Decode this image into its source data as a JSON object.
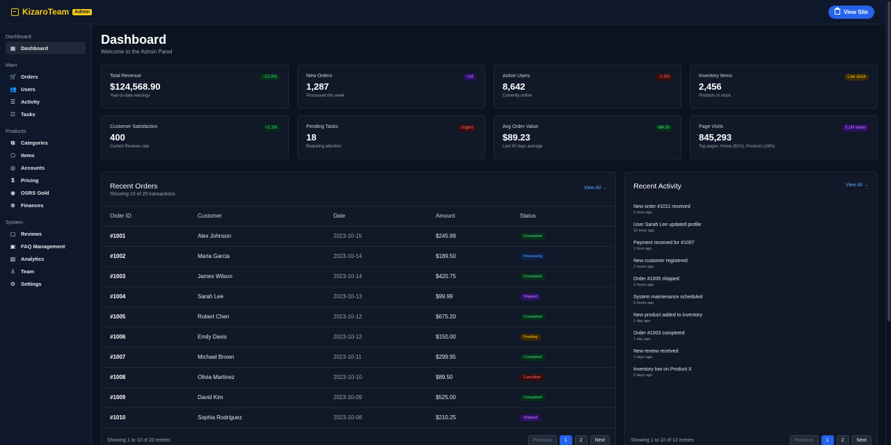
{
  "brand": {
    "name": "KizaroTeam",
    "badge": "Admin"
  },
  "header": {
    "view_site": "View Site"
  },
  "sidebar": {
    "sections": [
      {
        "title": "Dashboard",
        "items": [
          {
            "label": "Dashboard",
            "icon": "grid-icon",
            "active": true
          }
        ]
      },
      {
        "title": "Main",
        "items": [
          {
            "label": "Orders",
            "icon": "cart-icon"
          },
          {
            "label": "Users",
            "icon": "users-icon"
          },
          {
            "label": "Activity",
            "icon": "activity-icon"
          },
          {
            "label": "Tasks",
            "icon": "tasks-icon"
          }
        ]
      },
      {
        "title": "Products",
        "items": [
          {
            "label": "Categories",
            "icon": "categories-icon"
          },
          {
            "label": "Items",
            "icon": "box-icon"
          },
          {
            "label": "Accounts",
            "icon": "account-icon"
          },
          {
            "label": "Pricing",
            "icon": "dollar-icon"
          },
          {
            "label": "OSRS Gold",
            "icon": "coins-icon"
          },
          {
            "label": "Finances",
            "icon": "finance-icon"
          }
        ]
      },
      {
        "title": "System",
        "items": [
          {
            "label": "Reviews",
            "icon": "chat-icon"
          },
          {
            "label": "FAQ Management",
            "icon": "faq-icon"
          },
          {
            "label": "Analytics",
            "icon": "chart-icon"
          },
          {
            "label": "Team",
            "icon": "user-icon"
          },
          {
            "label": "Settings",
            "icon": "gear-icon"
          }
        ]
      }
    ]
  },
  "page": {
    "title": "Dashboard",
    "subtitle": "Welcome to the Admin Panel"
  },
  "stats": [
    {
      "label": "Total Revenue",
      "value": "$124,568.90",
      "sub": "Year-to-date earnings",
      "pill": "+12.5%",
      "pill_color": "green"
    },
    {
      "label": "New Orders",
      "value": "1,287",
      "sub": "Processed this week",
      "pill": "+34",
      "pill_color": "purple"
    },
    {
      "label": "Active Users",
      "value": "8,642",
      "sub": "Currently online",
      "pill": "-2.3%",
      "pill_color": "red"
    },
    {
      "label": "Inventory Items",
      "value": "2,456",
      "sub": "Products in stock",
      "pill": "Low stock",
      "pill_color": "yellow"
    },
    {
      "label": "Customer Satisfaction",
      "value": "400",
      "sub": "Current Reviews rate",
      "pill": "+2.1%",
      "pill_color": "green"
    },
    {
      "label": "Pending Tasks",
      "value": "18",
      "sub": "Requiring attention",
      "pill": "Urgent",
      "pill_color": "red"
    },
    {
      "label": "Avg Order Value",
      "value": "$89.23",
      "sub": "Last 30 days average",
      "pill": "+$4.50",
      "pill_color": "green"
    },
    {
      "label": "Page Visits",
      "value": "845,293",
      "sub": "Top pages: Home (62%), Products (28%)",
      "pill": "3.1M views",
      "pill_color": "purple"
    }
  ],
  "orders": {
    "title": "Recent Orders",
    "subtitle": "Showing 10 of 20 transactions",
    "view_all": "View All →",
    "columns": [
      "Order ID",
      "Customer",
      "Date",
      "Amount",
      "Status"
    ],
    "rows": [
      {
        "id": "#1001",
        "customer": "Alex Johnson",
        "date": "2023-10-15",
        "amount": "$245.99",
        "status": "Completed"
      },
      {
        "id": "#1002",
        "customer": "Maria Garcia",
        "date": "2023-10-14",
        "amount": "$189.50",
        "status": "Processing"
      },
      {
        "id": "#1003",
        "customer": "James Wilson",
        "date": "2023-10-14",
        "amount": "$420.75",
        "status": "Completed"
      },
      {
        "id": "#1004",
        "customer": "Sarah Lee",
        "date": "2023-10-13",
        "amount": "$99.99",
        "status": "Shipped"
      },
      {
        "id": "#1005",
        "customer": "Robert Chen",
        "date": "2023-10-12",
        "amount": "$675.20",
        "status": "Completed"
      },
      {
        "id": "#1006",
        "customer": "Emily Davis",
        "date": "2023-10-12",
        "amount": "$150.00",
        "status": "Pending"
      },
      {
        "id": "#1007",
        "customer": "Michael Brown",
        "date": "2023-10-11",
        "amount": "$299.95",
        "status": "Completed"
      },
      {
        "id": "#1008",
        "customer": "Olivia Martinez",
        "date": "2023-10-10",
        "amount": "$89.50",
        "status": "Cancelled"
      },
      {
        "id": "#1009",
        "customer": "David Kim",
        "date": "2023-10-09",
        "amount": "$525.00",
        "status": "Completed"
      },
      {
        "id": "#1010",
        "customer": "Sophia Rodriguez",
        "date": "2023-10-08",
        "amount": "$210.25",
        "status": "Shipped"
      }
    ],
    "footer": "Showing 1 to 10 of 20 entries",
    "pager": {
      "prev": "Previous",
      "pages": [
        "1",
        "2"
      ],
      "next": "Next"
    }
  },
  "activity": {
    "title": "Recent Activity",
    "view_all": "View All →",
    "items": [
      {
        "text": "New order #1011 received",
        "when": "2 mins ago"
      },
      {
        "text": "User Sarah Lee updated profile",
        "when": "15 mins ago"
      },
      {
        "text": "Payment received for #1007",
        "when": "1 hour ago"
      },
      {
        "text": "New customer registered",
        "when": "2 hours ago"
      },
      {
        "text": "Order #1005 shipped",
        "when": "3 hours ago"
      },
      {
        "text": "System maintenance scheduled",
        "when": "5 hours ago"
      },
      {
        "text": "New product added to inventory",
        "when": "1 day ago"
      },
      {
        "text": "Order #1003 completed",
        "when": "1 day ago"
      },
      {
        "text": "New review received",
        "when": "2 days ago"
      },
      {
        "text": "Inventory low on Product X",
        "when": "2 days ago"
      }
    ],
    "footer": "Showing 1 to 10 of 12 entries",
    "pager": {
      "prev": "Previous",
      "pages": [
        "1",
        "2"
      ],
      "next": "Next"
    }
  }
}
